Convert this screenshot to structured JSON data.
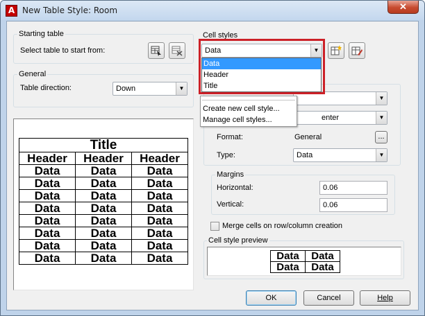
{
  "window": {
    "title": "New Table Style: Room",
    "close_glyph": "✕",
    "app_icon_letter": "A"
  },
  "starting_table": {
    "group_label": "Starting table",
    "select_label": "Select table to start from:"
  },
  "general": {
    "group_label": "General",
    "direction_label": "Table direction:",
    "direction_value": "Down"
  },
  "preview_table": {
    "title": "Title",
    "headers": [
      "Header",
      "Header",
      "Header"
    ],
    "rows": [
      [
        "Data",
        "Data",
        "Data"
      ],
      [
        "Data",
        "Data",
        "Data"
      ],
      [
        "Data",
        "Data",
        "Data"
      ],
      [
        "Data",
        "Data",
        "Data"
      ],
      [
        "Data",
        "Data",
        "Data"
      ],
      [
        "Data",
        "Data",
        "Data"
      ],
      [
        "Data",
        "Data",
        "Data"
      ],
      [
        "Data",
        "Data",
        "Data"
      ]
    ]
  },
  "cell_styles": {
    "group_label": "Cell styles",
    "selected": "Data",
    "options": [
      "Data",
      "Header",
      "Title"
    ],
    "menu": [
      "Create new cell style...",
      "Manage cell styles..."
    ]
  },
  "properties": {
    "alignment_partial": "enter",
    "format_label": "Format:",
    "format_value": "General",
    "format_button": "...",
    "type_label": "Type:",
    "type_value": "Data",
    "margins_label": "Margins",
    "horizontal_label": "Horizontal:",
    "horizontal_value": "0.06",
    "vertical_label": "Vertical:",
    "vertical_value": "0.06",
    "merge_label": "Merge cells on row/column creation"
  },
  "cell_preview": {
    "label": "Cell style preview",
    "cells": [
      [
        "Data",
        "Data"
      ],
      [
        "Data",
        "Data"
      ]
    ]
  },
  "buttons": {
    "ok": "OK",
    "cancel": "Cancel",
    "help": "Help"
  },
  "colors": {
    "highlight": "#cc2027",
    "selection": "#3399ff",
    "title_bar": "#c3d7ee"
  }
}
